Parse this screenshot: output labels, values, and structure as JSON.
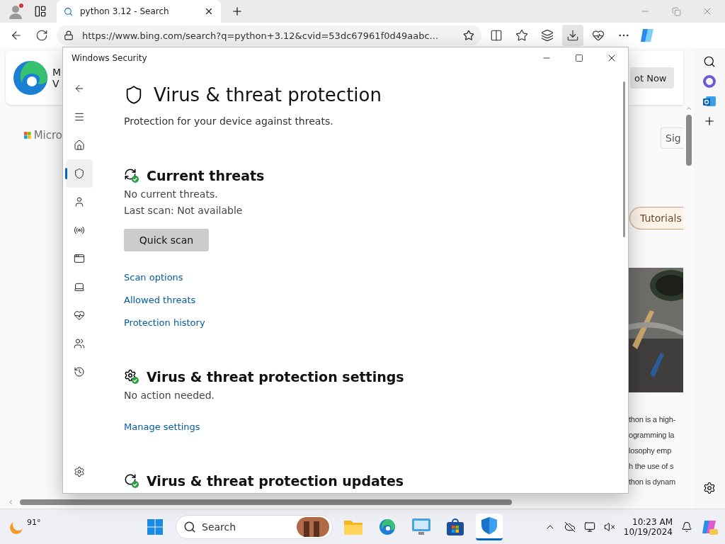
{
  "browser": {
    "tab": {
      "title": "python 3.12 - Search"
    },
    "address": {
      "url": "https://www.bing.com/search?q=python+3.12&cvid=53dc67961f0d49aabc..."
    }
  },
  "page_behind": {
    "banner_letters": [
      "M",
      "V"
    ],
    "brand": "Micro",
    "banner_button": "ot Now",
    "sign_in": "Sig",
    "chip": "Tutorials",
    "paragraph": [
      "thon is a high-",
      "ogramming la",
      "losophy emp",
      "h the use of s",
      "thon is dynam"
    ]
  },
  "security_window": {
    "title": "Windows Security",
    "nav": [
      {
        "kind": "back",
        "selected": false
      },
      {
        "kind": "menu",
        "selected": false
      },
      {
        "kind": "home",
        "selected": false
      },
      {
        "kind": "shield",
        "selected": true
      },
      {
        "kind": "account",
        "selected": false
      },
      {
        "kind": "network",
        "selected": false
      },
      {
        "kind": "app",
        "selected": false
      },
      {
        "kind": "device",
        "selected": false
      },
      {
        "kind": "health",
        "selected": false
      },
      {
        "kind": "family",
        "selected": false
      },
      {
        "kind": "history",
        "selected": false
      },
      {
        "kind": "settings",
        "selected": false
      }
    ],
    "heading": "Virus & threat protection",
    "subtitle": "Protection for your device against threats.",
    "sections": [
      {
        "kind": "threats",
        "title": "Current threats",
        "lines": [
          "No current threats.",
          "Last scan: Not available"
        ],
        "button": "Quick scan",
        "links": [
          "Scan options",
          "Allowed threats",
          "Protection history"
        ]
      },
      {
        "kind": "settings",
        "title": "Virus & threat protection settings",
        "lines": [
          "No action needed."
        ],
        "links": [
          "Manage settings"
        ]
      },
      {
        "kind": "updates",
        "title": "Virus & threat protection updates"
      }
    ]
  },
  "taskbar": {
    "weather": "91°",
    "search": "Search",
    "time": "10:23 AM",
    "date": "10/19/2024"
  }
}
